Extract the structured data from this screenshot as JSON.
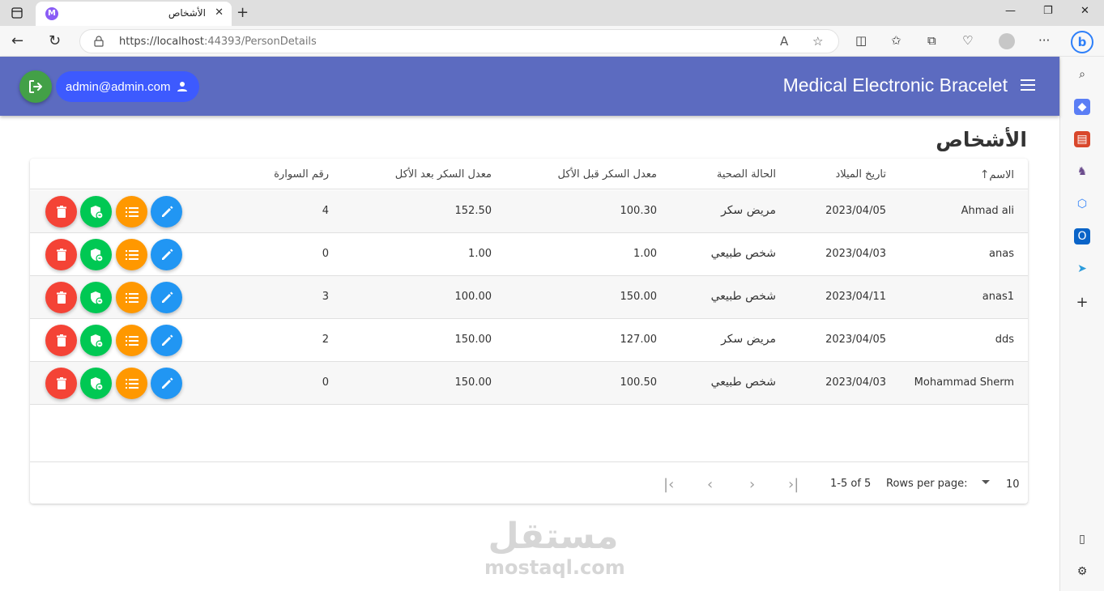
{
  "browser": {
    "tab_title": "الأشخاص",
    "url_scheme_host": "https://localhost",
    "url_rest": ":44393/PersonDetails"
  },
  "app": {
    "title": "Medical Electronic Bracelet",
    "user_email": "admin@admin.com",
    "page_title": "الأشخاص"
  },
  "table": {
    "headers": {
      "name": "الاسم",
      "birth_date": "تاريخ الميلاد",
      "health_status": "الحالة الصحية",
      "sugar_before": "معدل السكر قبل الأكل",
      "sugar_after": "معدل السكر بعد الأكل",
      "bracelet_no": "رقم السوارة"
    },
    "rows": [
      {
        "name": "Ahmad ali",
        "birth_date": "2023/04/05",
        "health_status": "مريض سكر",
        "sugar_before": "100.30",
        "sugar_after": "152.50",
        "bracelet_no": "4"
      },
      {
        "name": "anas",
        "birth_date": "2023/04/03",
        "health_status": "شخص طبيعي",
        "sugar_before": "1.00",
        "sugar_after": "1.00",
        "bracelet_no": "0"
      },
      {
        "name": "anas1",
        "birth_date": "2023/04/11",
        "health_status": "شخص طبيعي",
        "sugar_before": "150.00",
        "sugar_after": "100.00",
        "bracelet_no": "3"
      },
      {
        "name": "dds",
        "birth_date": "2023/04/05",
        "health_status": "مريض سكر",
        "sugar_before": "127.00",
        "sugar_after": "150.00",
        "bracelet_no": "2"
      },
      {
        "name": "Mohammad Sherm",
        "birth_date": "2023/04/03",
        "health_status": "شخص طبيعي",
        "sugar_before": "100.50",
        "sugar_after": "150.00",
        "bracelet_no": "0"
      }
    ]
  },
  "pagination": {
    "range": "1-5 of 5",
    "rows_per_page_label": "Rows per page:",
    "rows_per_page_value": "10"
  },
  "watermark": {
    "arabic": "مستقل",
    "latin": "mostaql.com"
  },
  "colors": {
    "appbar": "#5c6bc0",
    "user_chip": "#3d5afe",
    "logout": "#43a047",
    "delete": "#f44336",
    "security": "#00c853",
    "details": "#ff9800",
    "edit": "#2196f3"
  }
}
